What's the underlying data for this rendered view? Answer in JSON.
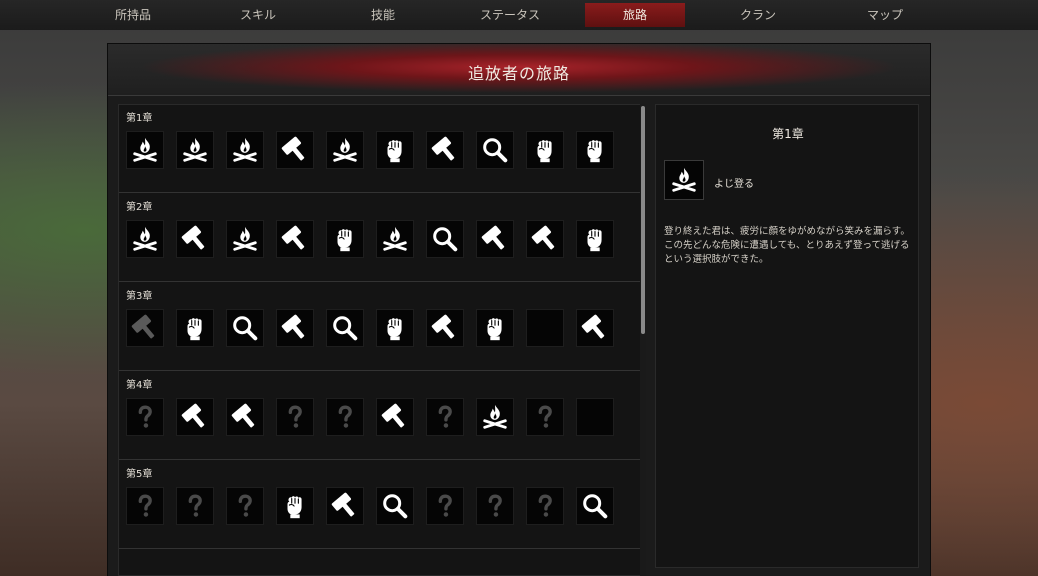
{
  "nav": {
    "tabs": [
      {
        "label": "所持品",
        "active": false
      },
      {
        "label": "スキル",
        "active": false
      },
      {
        "label": "技能",
        "active": false
      },
      {
        "label": "ステータス",
        "active": false
      },
      {
        "label": "旅路",
        "active": true
      },
      {
        "label": "クラン",
        "active": false
      },
      {
        "label": "マップ",
        "active": false
      }
    ]
  },
  "window": {
    "title": "追放者の旅路"
  },
  "chapters": [
    {
      "label": "第1章",
      "icons": [
        "campfire-icon",
        "campfire-icon",
        "campfire-icon",
        "hammer-icon",
        "campfire-icon",
        "fist-icon",
        "hammer-icon",
        "magnifier-icon",
        "fist-icon",
        "fist-icon"
      ]
    },
    {
      "label": "第2章",
      "icons": [
        "campfire-icon",
        "hammer-icon",
        "campfire-icon",
        "hammer-icon",
        "fist-icon",
        "campfire-icon",
        "magnifier-icon",
        "hammer-icon",
        "hammer-icon",
        "fist-icon"
      ]
    },
    {
      "label": "第3章",
      "icons": [
        "hammer-dim-icon",
        "fist-icon",
        "magnifier-icon",
        "hammer-icon",
        "magnifier-icon",
        "fist-icon",
        "hammer-icon",
        "fist-icon",
        "empty",
        "hammer-icon"
      ]
    },
    {
      "label": "第4章",
      "icons": [
        "question-icon",
        "hammer-icon",
        "hammer-icon",
        "question-icon",
        "question-icon",
        "hammer-icon",
        "question-icon",
        "campfire-icon",
        "question-icon",
        "empty"
      ]
    },
    {
      "label": "第5章",
      "icons": [
        "question-icon",
        "question-icon",
        "question-icon",
        "fist-icon",
        "hammer-icon",
        "magnifier-icon",
        "question-icon",
        "question-icon",
        "question-icon",
        "magnifier-icon"
      ]
    }
  ],
  "detail": {
    "title": "第1章",
    "icon": "campfire-icon",
    "name": "よじ登る",
    "text": "登り終えた君は、疲労に顔をゆがめながら笑みを漏らす。この先どんな危険に遭遇しても、とりあえず登って逃げるという選択肢ができた。"
  },
  "colors": {
    "accent": "#8a1c1c",
    "icon_fill": "#ffffff",
    "unknown_icon": "#4a4a4a"
  }
}
